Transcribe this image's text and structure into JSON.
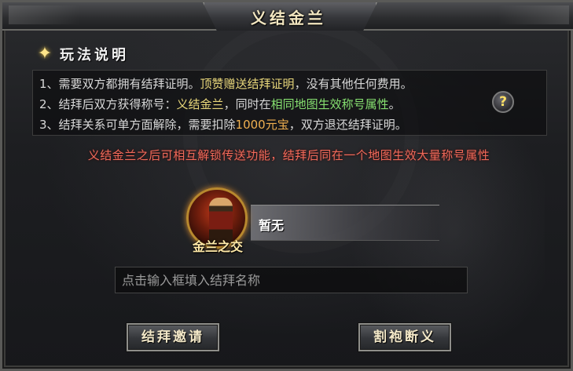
{
  "window": {
    "title": "义结金兰"
  },
  "section": {
    "title": "玩法说明"
  },
  "rules": [
    {
      "p1": "1、需要双方都拥有结拜证明。",
      "p2": "顶赞赠送结拜证明",
      "p3": "，没有其他任何费用。"
    },
    {
      "p1": "2、结拜后双方获得称号：",
      "p2": "义结金兰",
      "p3": "，同时在",
      "p4": "相同地图生效称号属性",
      "p5": "。"
    },
    {
      "p1": "3、结拜关系可单方面解除，需要扣除",
      "p2": "1000元宝",
      "p3": "，双方退还结拜证明。"
    }
  ],
  "help_icon": {
    "glyph": "?"
  },
  "notice": "义结金兰之后可相互解锁传送功能，结拜后同在一个地图生效大量称号属性",
  "partner": {
    "title_label": "金兰之交",
    "name": "暂无"
  },
  "name_input": {
    "placeholder": "点击输入框填入结拜名称",
    "value": ""
  },
  "buttons": {
    "invite": "结拜邀请",
    "break": "割袍断义"
  },
  "colors": {
    "highlight_yellow": "#e8d67a",
    "highlight_green": "#86e070",
    "highlight_orange": "#f0b050",
    "notice_red": "#f06a5a"
  }
}
